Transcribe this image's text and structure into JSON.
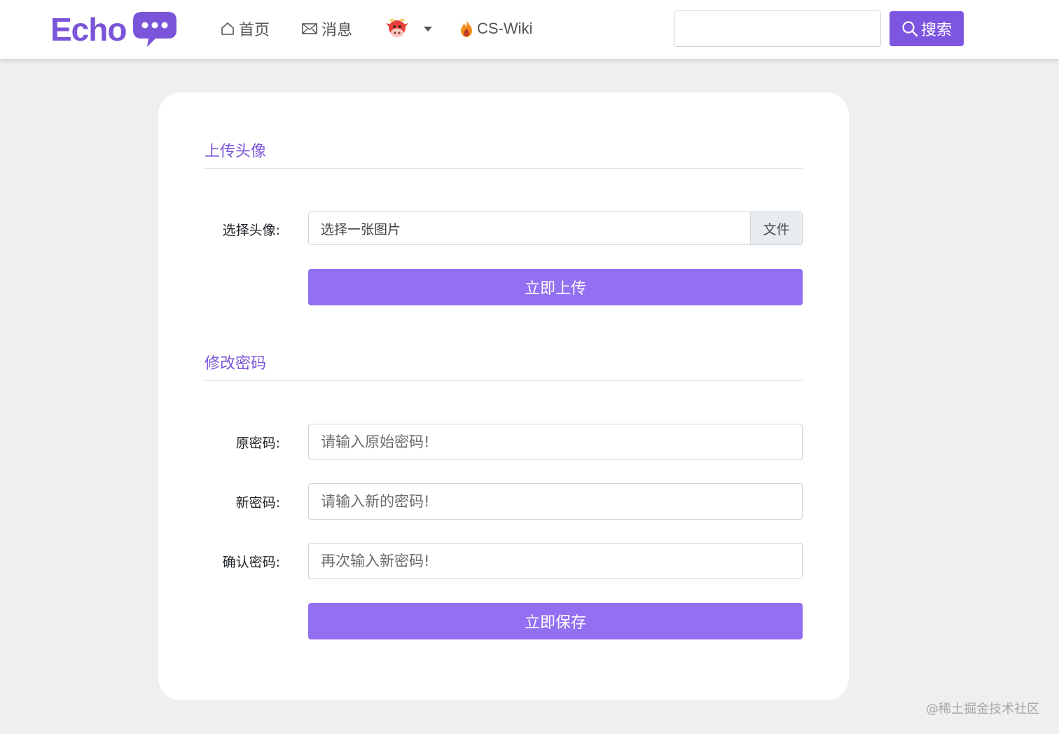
{
  "header": {
    "brand": "Echo",
    "nav": {
      "home": "首页",
      "messages": "消息",
      "wiki": "CS-Wiki"
    },
    "search": {
      "placeholder": "",
      "button_label": "搜索"
    }
  },
  "upload_section": {
    "title": "上传头像",
    "label": "选择头像:",
    "file_placeholder": "选择一张图片",
    "file_button": "文件",
    "submit_label": "立即上传"
  },
  "password_section": {
    "title": "修改密码",
    "fields": [
      {
        "label": "原密码:",
        "placeholder": "请输入原始密码!"
      },
      {
        "label": "新密码:",
        "placeholder": "请输入新的密码!"
      },
      {
        "label": "确认密码:",
        "placeholder": "再次输入新密码!"
      }
    ],
    "submit_label": "立即保存"
  },
  "watermark": "@稀土掘金技术社区",
  "colors": {
    "accent": "#7c55e0",
    "button": "#9370f1",
    "background": "#efefef"
  },
  "icons": [
    "home-icon",
    "mail-icon",
    "cow-avatar-icon",
    "fire-icon",
    "search-icon",
    "chat-bubble-icon"
  ]
}
